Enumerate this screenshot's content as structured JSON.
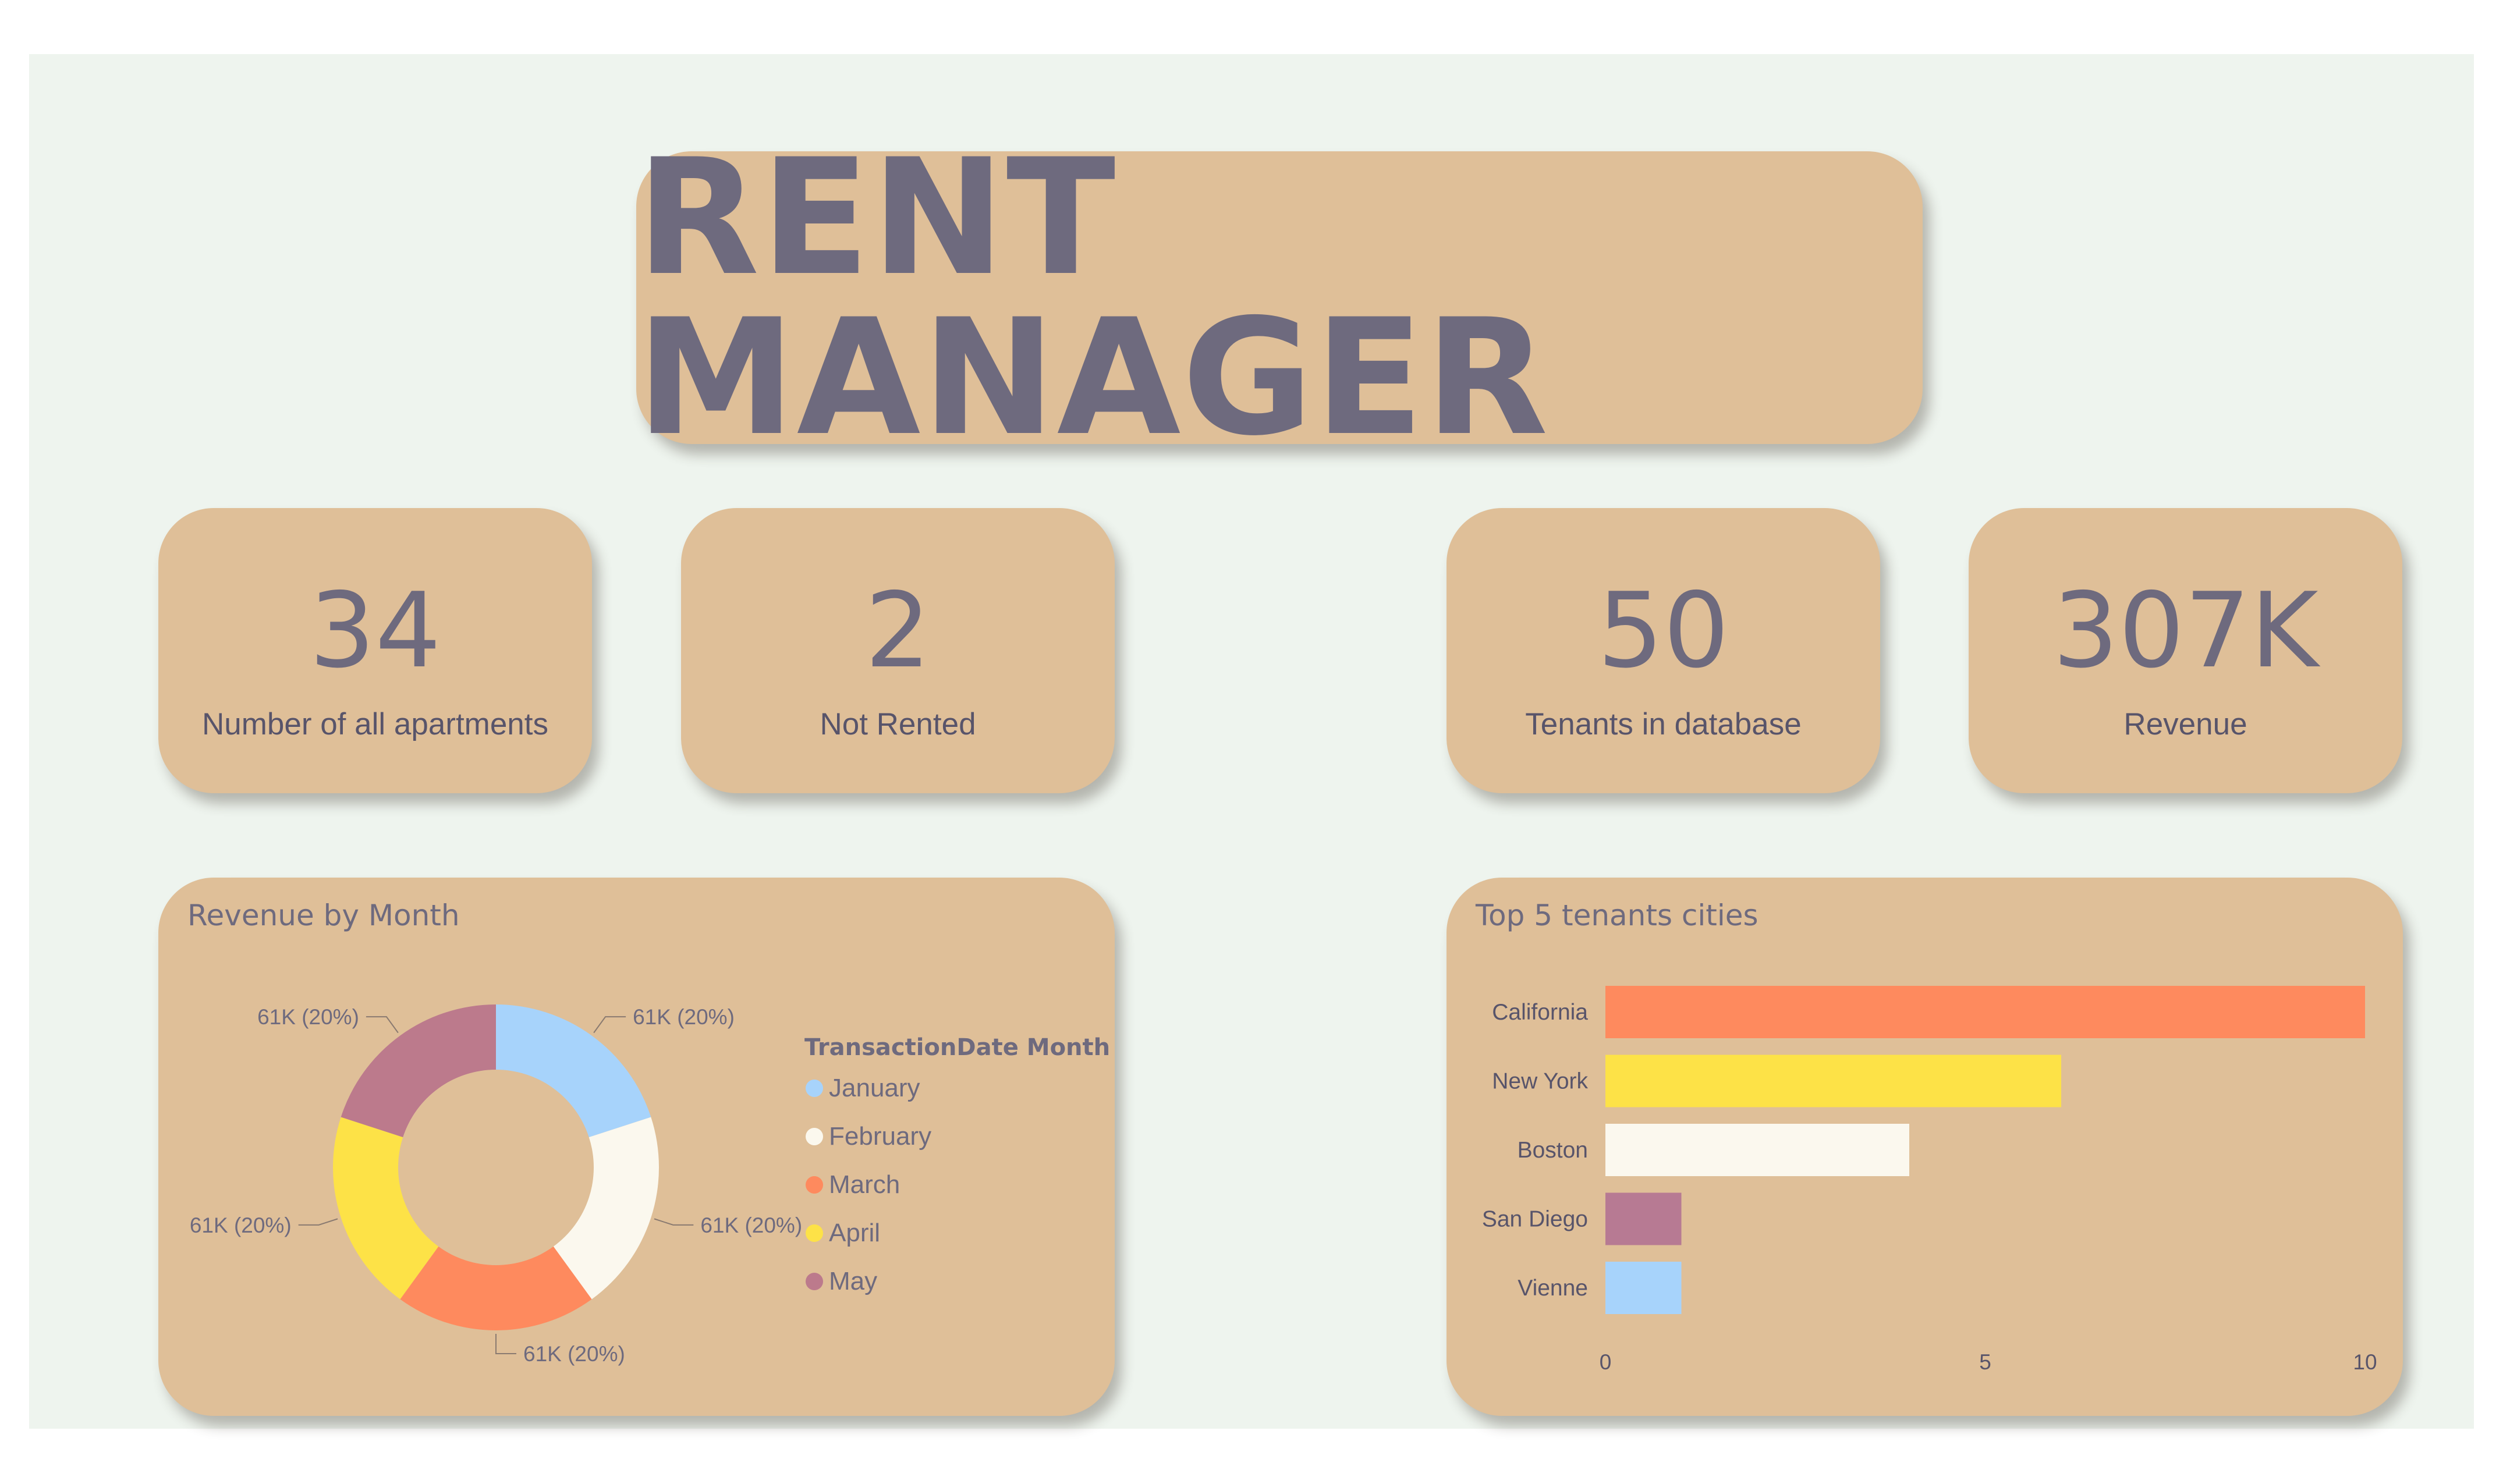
{
  "header": {
    "title": "RENT MANAGER"
  },
  "kpis": [
    {
      "value": "34",
      "label": "Number of all apartments"
    },
    {
      "value": "2",
      "label": "Not Rented"
    },
    {
      "value": "50",
      "label": "Tenants in database"
    },
    {
      "value": "307K",
      "label": "Revenue"
    }
  ],
  "colors": {
    "canvas": "#eef4ee",
    "card": "#dfbf98",
    "title_text": "#6e6a7e",
    "january": "#a7d3fb",
    "february": "#fbf8ee",
    "march": "#fe8a5e",
    "april": "#fde247",
    "may": "#bc7a8c",
    "sandiego": "#b77a93"
  },
  "chart_data": [
    {
      "type": "pie",
      "title": "Revenue by Month",
      "legend_title": "TransactionDate Month",
      "legend_placement": "right",
      "categories": [
        "January",
        "February",
        "March",
        "April",
        "May"
      ],
      "values": [
        61,
        61,
        61,
        61,
        61
      ],
      "data_labels": [
        "61K (20%)",
        "61K (20%)",
        "61K (20%)",
        "61K (20%)",
        "61K (20%)"
      ],
      "colors": [
        "#a7d3fb",
        "#fbf8ee",
        "#fe8a5e",
        "#fde247",
        "#bc7a8c"
      ]
    },
    {
      "type": "bar",
      "orientation": "horizontal",
      "title": "Top 5 tenants cities",
      "categories": [
        "California",
        "New York",
        "Boston",
        "San Diego",
        "Vienne"
      ],
      "values": [
        10,
        6,
        4,
        1,
        1
      ],
      "colors": [
        "#fe8a5e",
        "#fde247",
        "#fbf8ee",
        "#b77a93",
        "#a7d3fb"
      ],
      "xlim": [
        0,
        10
      ],
      "xticks": [
        "0",
        "5",
        "10"
      ],
      "grid": false
    }
  ]
}
